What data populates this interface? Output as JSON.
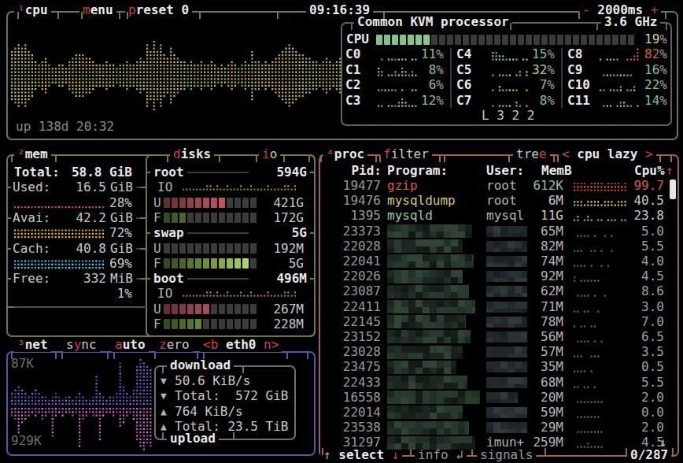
{
  "colors": {
    "accent_red": "#c0463e",
    "title_fg": "#e9e9e9",
    "main_fg": "#c8c8c8",
    "cpu_box_border": "#5e7b62",
    "cpu_inner_border": "#54675a",
    "mem_box_border": "#75754b",
    "net_box_border": "#5a55a8",
    "net_inner_border": "#707074",
    "proc_box_border": "#9d6156",
    "div_line": "#3c3c3c",
    "meter_bg": "#3b3b3b",
    "scrollbar": "#e6e6e6"
  },
  "cpu": {
    "sup": "¹",
    "title": "cpu",
    "menu_hot": "m",
    "menu_rest": "enu",
    "preset_hot": "p",
    "preset_rest": "reset 0",
    "clock": "09:16:39",
    "interval_minus": "-",
    "interval": "2000ms",
    "interval_plus": "+",
    "uptime": "up 138d 20:32",
    "inner": {
      "title": "Common KVM processor",
      "freq": "3.6 GHz",
      "meter_label": "CPU",
      "meter_value": "19",
      "meter_pct_sign": "%",
      "meter_blocks": 33,
      "meter_filled": 7,
      "load_avg": "L 3 2 2",
      "cores": [
        {
          "name": "C0",
          "value": "11",
          "graph": [
            0,
            1,
            0,
            1,
            1,
            1,
            1,
            1,
            1,
            0,
            1,
            1
          ]
        },
        {
          "name": "C4",
          "value": "15",
          "graph": [
            0,
            3,
            3,
            2,
            2,
            1,
            1,
            1,
            1,
            0,
            1,
            1
          ]
        },
        {
          "name": "C8",
          "value": "82",
          "pct_color": "#cf6a42",
          "graph": [
            1,
            0,
            1,
            1,
            1,
            1,
            0,
            0,
            1,
            1,
            2,
            4
          ],
          "red_from": 8
        },
        {
          "name": "C1",
          "value": "8",
          "graph": [
            3,
            2,
            0,
            1,
            1,
            2,
            1,
            3,
            2,
            1,
            2,
            1
          ]
        },
        {
          "name": "C5",
          "value": "32",
          "pct_color": "#c2cc76",
          "graph": [
            0,
            1,
            0,
            1,
            1,
            1,
            1,
            0,
            1,
            2,
            0,
            2
          ]
        },
        {
          "name": "C9",
          "value": "16",
          "graph": [
            0,
            1,
            1,
            1,
            1,
            1,
            1,
            1,
            1,
            1,
            0,
            0
          ]
        },
        {
          "name": "C2",
          "value": "6",
          "graph": [
            1,
            1,
            1,
            1,
            1,
            1,
            0,
            1,
            0,
            0,
            1,
            1
          ]
        },
        {
          "name": "C6",
          "value": "7",
          "graph": [
            0,
            1,
            0,
            2,
            1,
            1,
            1,
            1,
            1,
            0,
            0,
            1
          ]
        },
        {
          "name": "C10",
          "value": "22",
          "graph": [
            1,
            1,
            0,
            1,
            1,
            1,
            2,
            0,
            1,
            1,
            2,
            0
          ]
        },
        {
          "name": "C3",
          "value": "12",
          "graph": [
            1,
            1,
            0,
            1,
            1,
            1,
            2,
            3,
            2,
            1,
            1,
            1
          ]
        },
        {
          "name": "C7",
          "value": "8",
          "graph": [
            0,
            1,
            0,
            1,
            1,
            1,
            1,
            0,
            2,
            1,
            0,
            1
          ]
        },
        {
          "name": "C11",
          "value": "14",
          "graph": [
            0,
            1,
            1,
            1,
            0,
            1,
            2,
            2,
            1,
            1,
            0,
            1
          ]
        }
      ]
    },
    "wave": [
      8,
      9,
      10,
      9,
      10,
      8,
      7,
      5,
      4,
      5,
      6,
      4,
      3,
      3,
      4,
      4,
      3,
      5,
      6,
      7,
      7,
      7,
      6,
      6,
      5,
      4,
      4,
      4,
      5,
      4,
      4,
      3,
      4,
      4,
      5,
      4,
      4,
      5,
      6,
      5,
      10,
      8,
      11,
      8,
      10,
      7,
      6,
      9,
      7,
      6,
      5,
      5,
      4,
      5,
      4,
      4,
      5,
      4,
      4,
      5,
      4,
      3,
      4,
      3,
      4,
      5,
      4,
      3,
      4,
      5,
      4,
      8,
      5,
      5,
      4,
      5,
      4,
      5,
      6,
      7,
      8,
      9,
      10,
      9,
      8,
      7,
      7,
      6,
      6,
      5,
      5,
      4,
      5,
      6,
      5,
      4,
      5,
      6
    ]
  },
  "mem": {
    "sup": "²",
    "title": "mem",
    "total_label": "Total:",
    "total_value": "58.8 GiB",
    "stats": [
      {
        "label": "Used:",
        "value": "16.5",
        "unit": "GiB",
        "pct": "28%",
        "kind": "used",
        "rows": 1
      },
      {
        "label": "Avai:",
        "value": "42.2",
        "unit": "GiB",
        "pct": "72%",
        "kind": "available",
        "rows": 3
      },
      {
        "label": "Cach:",
        "value": "40.8",
        "unit": "GiB",
        "pct": "69%",
        "kind": "cached",
        "rows": 3
      },
      {
        "label": "Free:",
        "value": "332",
        "unit": "MiB",
        "pct": "1%",
        "kind": "free",
        "rows": 0
      }
    ]
  },
  "disks": {
    "hot": "d",
    "title_rest": "isks",
    "io_hot": "i",
    "io_rest": "o",
    "io_label": "IO",
    "used_label": "U",
    "free_label": "F",
    "entries": [
      {
        "name": "root",
        "size": "594G",
        "has_io": true,
        "io_graph": [
          1,
          1,
          1,
          1,
          1,
          1,
          1,
          2,
          2,
          1,
          2,
          1,
          1,
          2,
          1,
          1,
          1,
          2,
          1,
          1,
          2,
          1,
          1,
          1,
          1,
          2,
          1,
          1,
          1,
          1,
          2,
          2,
          1,
          2
        ],
        "used_value": "421G",
        "used_filled": 8,
        "free_value": "172G",
        "free_filled": 3
      },
      {
        "name": "swap",
        "size": "5G",
        "has_io": false,
        "used_value": "192M",
        "used_filled": 0,
        "free_value": "5G",
        "free_filled": 11
      },
      {
        "name": "boot",
        "size": "496M",
        "has_io": true,
        "io_graph": [
          1,
          1,
          1,
          1,
          1,
          1,
          1,
          2,
          2,
          1,
          2,
          1,
          1,
          2,
          1,
          1,
          1,
          2,
          1,
          1,
          2,
          1,
          1,
          1,
          1,
          2,
          1,
          1,
          1,
          1,
          2,
          2,
          1,
          2
        ],
        "used_value": "267M",
        "used_filled": 6,
        "free_value": "228M",
        "free_filled": 5
      }
    ]
  },
  "net": {
    "sup": "³",
    "title": "net",
    "sync_pre": "s",
    "sync_hot": "y",
    "sync_rest": "nc",
    "auto_hot": "a",
    "auto_rest": "uto",
    "zero_hot": "z",
    "zero_rest": "ero",
    "iface_left": "<b",
    "iface": "eth0",
    "iface_right": "n>",
    "scale_top": "87K",
    "scale_bottom": "929K",
    "download_title": "download",
    "upload_title": "upload",
    "rows": [
      {
        "arrow": "▼",
        "text": "50.6 KiB/s"
      },
      {
        "arrow": "▼",
        "text": "Total:  572 GiB"
      },
      {
        "arrow": "▲",
        "text": "764 KiB/s"
      },
      {
        "arrow": "▲",
        "text": "Total: 23.5 TiB"
      }
    ],
    "download_graph": [
      4,
      5,
      6,
      5,
      4,
      3,
      4,
      5,
      4,
      3,
      3,
      2,
      3,
      4,
      3,
      2,
      3,
      3,
      2,
      3,
      4,
      3,
      2,
      2,
      3,
      9,
      4,
      3,
      2,
      3,
      3,
      4,
      13,
      6,
      4,
      3,
      5,
      12,
      14,
      13,
      12,
      11
    ],
    "upload_graph": [
      3,
      4,
      8,
      5,
      4,
      3,
      2,
      3,
      2,
      4,
      3,
      2,
      9,
      3,
      2,
      3,
      2,
      2,
      3,
      2,
      12,
      4,
      3,
      2,
      3,
      3,
      10,
      3,
      2,
      2,
      3,
      2,
      6,
      5,
      3,
      2,
      4,
      10,
      12,
      13,
      11,
      12
    ]
  },
  "proc": {
    "sup": "⁴",
    "title": "proc",
    "filter_hot": "f",
    "filter_rest": "ilter",
    "tree_pre": "tre",
    "tree_hot": "e",
    "sort_left": "<",
    "sort_label": "cpu lazy",
    "sort_right": ">",
    "headers": {
      "pid": "Pid:",
      "program": "Program:",
      "user": "User:",
      "mem": "MemB",
      "cpu": "Cpu%",
      "sort_arrow": "↑"
    },
    "scroll_down_arrow": "↓",
    "rows": [
      {
        "pid": "19477",
        "program": "gzip",
        "program_color": "#cf5b50",
        "user": "root",
        "mem": "612K",
        "mem_color": "#82c491",
        "cpu": "99.7",
        "cpu_color": "#cf5b50",
        "gkind": "red",
        "graph": [
          3,
          3,
          3,
          3,
          2,
          3,
          3,
          3,
          3,
          2,
          3,
          3,
          3,
          3,
          2,
          3
        ]
      },
      {
        "pid": "19476",
        "program": "mysqldump",
        "program_color": "#d3c87b",
        "user": "root",
        "mem": "6M",
        "cpu": "40.5",
        "cpu_color": "#c8c8c8",
        "gkind": "yellow",
        "graph": [
          2,
          2,
          2,
          1,
          2,
          2,
          2,
          2,
          1,
          2,
          2,
          2,
          1,
          2,
          2,
          2
        ]
      },
      {
        "pid": "1395",
        "program": "mysqld",
        "program_color": "#8ed0a3",
        "user": "mysql",
        "mem": "11G",
        "cpu": "23.8",
        "cpu_color": "#c8c8c8",
        "gkind": "green",
        "graph": [
          1,
          2,
          0,
          1,
          2,
          1,
          0,
          1,
          1,
          0,
          1,
          1,
          1,
          0,
          1,
          1
        ]
      },
      {
        "pid": "23373",
        "blur_program": 108,
        "blur_user": 52,
        "mem": "65M",
        "cpu": "5.0",
        "gkind": "faint",
        "graph": [
          0,
          1,
          1,
          1,
          1,
          0,
          1,
          0,
          0,
          1,
          0,
          1,
          0,
          0,
          0,
          0
        ]
      },
      {
        "pid": "22028",
        "blur_program": 96,
        "blur_user": 52,
        "mem": "82M",
        "cpu": "5.5",
        "gkind": "faint",
        "graph": [
          1,
          1,
          1,
          0,
          0,
          1,
          1,
          0,
          1,
          0,
          0,
          1,
          0,
          0,
          0,
          0
        ]
      },
      {
        "pid": "22041",
        "blur_program": 110,
        "blur_user": 52,
        "mem": "74M",
        "cpu": "4.0",
        "gkind": "faint",
        "graph": [
          1,
          1,
          1,
          1,
          0,
          1,
          0,
          0,
          1,
          0,
          1,
          0,
          0,
          0,
          0,
          0
        ]
      },
      {
        "pid": "22026",
        "blur_program": 96,
        "blur_user": 52,
        "mem": "92M",
        "cpu": "4.5",
        "gkind": "faint",
        "graph": [
          2,
          0,
          1,
          1,
          1,
          1,
          1,
          1,
          0,
          0,
          0,
          0,
          0,
          0,
          0,
          0
        ]
      },
      {
        "pid": "23087",
        "blur_program": 104,
        "blur_user": 52,
        "mem": "62M",
        "cpu": "8.6",
        "gkind": "faint",
        "graph": [
          0,
          1,
          1,
          1,
          1,
          0,
          1,
          0,
          0,
          1,
          0,
          0,
          0,
          0,
          0,
          0
        ]
      },
      {
        "pid": "22411",
        "blur_program": 112,
        "blur_user": 52,
        "mem": "71M",
        "cpu": "3.0",
        "gkind": "faint",
        "graph": [
          1,
          1,
          0,
          1,
          1,
          0,
          0,
          1,
          0,
          0,
          0,
          0,
          0,
          0,
          0,
          0
        ]
      },
      {
        "pid": "22145",
        "blur_program": 100,
        "blur_user": 52,
        "mem": "78M",
        "cpu": "7.0",
        "gkind": "faint",
        "graph": [
          1,
          0,
          1,
          1,
          0,
          1,
          1,
          0,
          0,
          0,
          0,
          0,
          0,
          0,
          0,
          0
        ]
      },
      {
        "pid": "23152",
        "blur_program": 106,
        "blur_user": 52,
        "mem": "56M",
        "cpu": "6.5",
        "gkind": "faint",
        "graph": [
          0,
          1,
          1,
          1,
          1,
          0,
          1,
          0,
          1,
          0,
          0,
          0,
          0,
          0,
          0,
          0
        ]
      },
      {
        "pid": "23028",
        "blur_program": 96,
        "blur_user": 52,
        "mem": "57M",
        "cpu": "3.5",
        "gkind": "faint",
        "graph": [
          1,
          1,
          1,
          0,
          0,
          1,
          1,
          1,
          0,
          0,
          0,
          0,
          0,
          0,
          0,
          0
        ]
      },
      {
        "pid": "23475",
        "blur_program": 88,
        "blur_user": 52,
        "mem": "35M",
        "cpu": "0.5",
        "gkind": "faint",
        "graph": [
          1,
          1,
          1,
          1,
          0,
          1,
          0,
          0,
          0,
          0,
          0,
          0,
          0,
          0,
          0,
          0
        ]
      },
      {
        "pid": "22433",
        "blur_program": 102,
        "blur_user": 52,
        "mem": "68M",
        "cpu": "5.5",
        "gkind": "faint",
        "graph": [
          1,
          1,
          0,
          1,
          1,
          0,
          1,
          0,
          0,
          0,
          0,
          0,
          0,
          0,
          0,
          0
        ]
      },
      {
        "pid": "16558",
        "blur_program": 118,
        "blur_user": 40,
        "mem": "20M",
        "cpu": "2.0",
        "gkind": "faint",
        "graph": [
          0,
          1,
          1,
          1,
          1,
          1,
          1,
          1,
          1,
          0,
          0,
          0,
          0,
          0,
          0,
          0
        ]
      },
      {
        "pid": "22014",
        "blur_program": 96,
        "blur_user": 52,
        "mem": "59M",
        "cpu": "0.0",
        "gkind": "faint",
        "graph": [
          0,
          1,
          1,
          1,
          1,
          1,
          1,
          1,
          0,
          0,
          0,
          0,
          0,
          0,
          0,
          0
        ]
      },
      {
        "pid": "23538",
        "blur_program": 104,
        "blur_user": 52,
        "mem": "29M",
        "cpu": "2.0",
        "gkind": "faint",
        "graph": [
          0,
          1,
          1,
          1,
          1,
          1,
          1,
          1,
          1,
          0,
          0,
          0,
          0,
          0,
          0,
          0
        ]
      },
      {
        "pid": "31297",
        "blur_program": 112,
        "user": "imun+",
        "mem": "259M",
        "cpu": "4.5",
        "gkind": "faint",
        "graph": [
          0,
          1,
          1,
          1,
          2,
          1,
          1,
          1,
          1,
          0,
          0,
          0,
          0,
          0,
          0,
          0
        ]
      }
    ],
    "footer": {
      "up": "↑",
      "select": "select",
      "down": "↓",
      "info": "info",
      "enter": "↲",
      "signals": "signals",
      "count": "0/287"
    }
  }
}
